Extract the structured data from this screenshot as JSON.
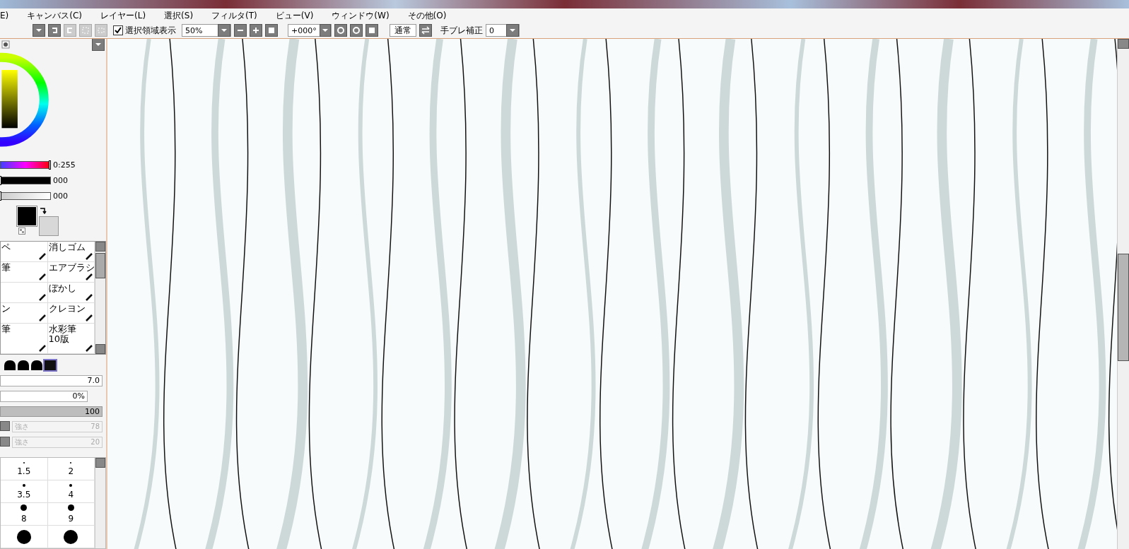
{
  "menu": [
    "E)",
    "キャンバス(C)",
    "レイヤー(L)",
    "選択(S)",
    "フィルタ(T)",
    "ビュー(V)",
    "ウィンドウ(W)",
    "その他(O)"
  ],
  "toolbar": {
    "selection_display": {
      "label": "選択領域表示",
      "checked": true
    },
    "zoom": "50%",
    "rotation": "+000°",
    "mode_button": "通常",
    "stabilizer": {
      "label": "手ブレ補正",
      "value": "0"
    }
  },
  "color_sliders": [
    {
      "kind": "hue",
      "level": 1,
      "reading": "0:255"
    },
    {
      "kind": "dark",
      "level": 0,
      "reading": "000"
    },
    {
      "kind": "light",
      "level": 0,
      "reading": "000"
    }
  ],
  "tools": [
    {
      "kind": "tool",
      "label": "ペ"
    },
    {
      "kind": "tool",
      "label": "消しゴム"
    },
    {
      "kind": "tool",
      "label": "筆"
    },
    {
      "kind": "tool",
      "label": "エアブラシ"
    },
    {
      "kind": "tool"
    },
    {
      "kind": "tool",
      "label": "ぼかし"
    },
    {
      "kind": "tool",
      "label": "ン"
    },
    {
      "kind": "tool",
      "label": "クレヨン"
    },
    {
      "kind": "tool",
      "label": "筆"
    },
    {
      "kind": "tool",
      "label": "水彩筆\n10版"
    }
  ],
  "brush_shapes": [
    {
      "selected": false
    },
    {
      "selected": false
    },
    {
      "selected": false
    },
    {
      "selected": true
    }
  ],
  "brush": {
    "size": "7.0",
    "min_size": "0%",
    "density": {
      "level": 1,
      "reading": "100"
    },
    "strengths": [
      {
        "label": "強さ",
        "value": "78",
        "disabled": true
      },
      {
        "label": "強さ",
        "value": "20",
        "disabled": true
      }
    ]
  },
  "brush_sizes": [
    "1.5",
    "2",
    "3.5",
    "4",
    "8",
    "9"
  ]
}
